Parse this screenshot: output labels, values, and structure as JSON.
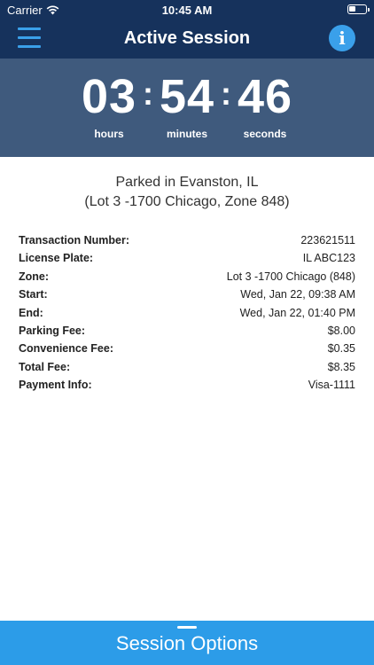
{
  "status_bar": {
    "carrier": "Carrier",
    "time": "10:45 AM"
  },
  "nav": {
    "title": "Active Session",
    "info_label": "i"
  },
  "timer": {
    "hours": "03",
    "minutes": "54",
    "seconds": "46",
    "separator": ":",
    "hours_label": "hours",
    "minutes_label": "minutes",
    "seconds_label": "seconds"
  },
  "location": {
    "line1": "Parked in Evanston, IL",
    "line2": "(Lot 3 -1700 Chicago, Zone 848)"
  },
  "details": [
    {
      "label": "Transaction Number:",
      "value": "223621511"
    },
    {
      "label": "License Plate:",
      "value": "IL ABC123"
    },
    {
      "label": "Zone:",
      "value": "Lot 3 -1700 Chicago (848)"
    },
    {
      "label": "Start:",
      "value": "Wed, Jan 22, 09:38 AM"
    },
    {
      "label": "End:",
      "value": "Wed, Jan 22, 01:40 PM"
    },
    {
      "label": "Parking Fee:",
      "value": "$8.00"
    },
    {
      "label": "Convenience Fee:",
      "value": "$0.35"
    },
    {
      "label": "Total Fee:",
      "value": "$8.35"
    },
    {
      "label": "Payment Info:",
      "value": "Visa-1111"
    }
  ],
  "footer": {
    "session_options_label": "Session Options"
  },
  "colors": {
    "navbar": "#16325c",
    "timer_bg": "#3f5a7d",
    "accent": "#2c9ce8"
  },
  "icons": {
    "menu": "menu-icon",
    "info": "info-icon",
    "wifi": "wifi-icon",
    "battery": "battery-icon",
    "handle": "drag-handle-icon"
  }
}
